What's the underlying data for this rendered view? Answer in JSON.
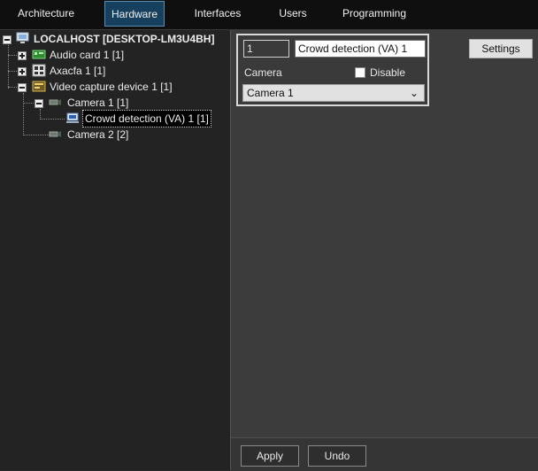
{
  "tabs": [
    {
      "label": "Architecture",
      "active": false
    },
    {
      "label": "Hardware",
      "active": true
    },
    {
      "label": "Interfaces",
      "active": false
    },
    {
      "label": "Users",
      "active": false
    },
    {
      "label": "Programming",
      "active": false
    }
  ],
  "tree": {
    "root": "LOCALHOST [DESKTOP-LM3U4BH]",
    "audio_card": "Audio card 1 [1]",
    "axxon": "Axacfa 1 [1]",
    "video_device": "Video capture device 1 [1]",
    "camera1": "Camera 1 [1]",
    "crowd": "Crowd detection (VA) 1 [1]",
    "camera2": "Camera 2 [2]"
  },
  "props": {
    "id_value": "1",
    "name_value": "Crowd detection (VA) 1",
    "camera_label": "Camera",
    "disable_label": "Disable",
    "disable_checked": false,
    "camera_selected": "Camera 1",
    "chevron": "⌄"
  },
  "buttons": {
    "settings": "Settings",
    "apply": "Apply",
    "undo": "Undo"
  },
  "colors": {
    "active_tab": "#16405e",
    "panel": "#3c3c3c",
    "tree_bg": "#232323"
  }
}
